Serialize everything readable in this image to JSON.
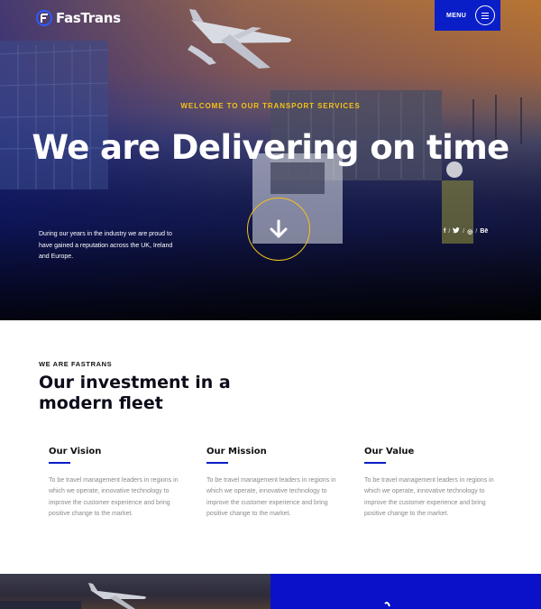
{
  "brand": {
    "name": "FasTrans"
  },
  "nav": {
    "menu_label": "MENU"
  },
  "hero": {
    "eyebrow": "WELCOME TO OUR TRANSPORT SERVICES",
    "title": "We are Delivering on time",
    "description": "During our years in the industry we are proud to have gained a reputation across the UK, Ireland and Europe.",
    "social": [
      {
        "icon": "facebook-icon",
        "glyph": "f"
      },
      {
        "icon": "twitter-icon",
        "glyph": "t"
      },
      {
        "icon": "dribbble-icon",
        "glyph": "◎"
      },
      {
        "icon": "behance-icon",
        "glyph": "Bē"
      }
    ],
    "separator": "/"
  },
  "about": {
    "eyebrow": "WE ARE FASTRANS",
    "title": "Our investment in a modern fleet",
    "columns": [
      {
        "title": "Our Vision",
        "text": "To be travel management leaders in regions in which we operate, innovative technology to improve the customer experience and bring positive change to the market."
      },
      {
        "title": "Our Mission",
        "text": "To be travel management leaders in regions in which we operate, innovative technology to improve the customer experience and bring positive change to the market."
      },
      {
        "title": "Our Value",
        "text": "To be travel management leaders in regions in which we operate, innovative technology to improve the customer experience and bring positive change to the market."
      }
    ]
  },
  "colors": {
    "accent_blue": "#0a1ec8",
    "accent_yellow": "#f4c21a"
  }
}
